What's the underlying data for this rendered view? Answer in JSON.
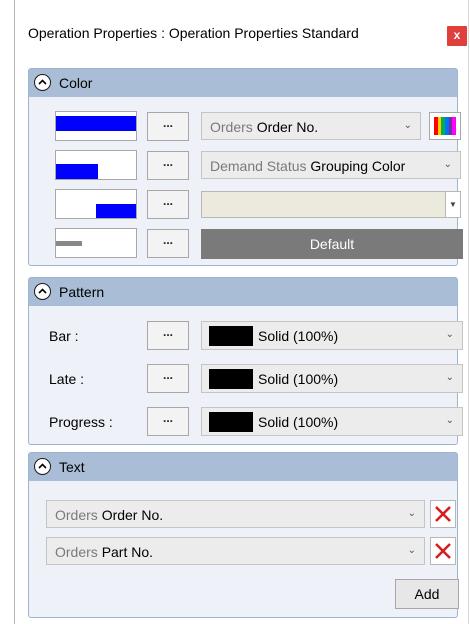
{
  "window": {
    "title": "Operation Properties : Operation Properties Standard",
    "close_label": "x"
  },
  "sections": {
    "color": {
      "title": "Color",
      "rows": [
        {
          "swatch": "full-blue-bar",
          "button_label": "...",
          "combo_prefix": "Orders",
          "combo_value": "Order No."
        },
        {
          "swatch": "partial-left-blue",
          "button_label": "...",
          "combo_prefix": "Demand Status",
          "combo_value": "Grouping Color"
        },
        {
          "swatch": "partial-right-blue",
          "button_label": "...",
          "combo_value": ""
        },
        {
          "swatch": "gray-dash",
          "button_label": "...",
          "default_label": "Default"
        }
      ],
      "palette_colors": [
        "#ff0000",
        "#ffcc00",
        "#00b050",
        "#0070ff",
        "#7030a0",
        "#ff00ff"
      ]
    },
    "pattern": {
      "title": "Pattern",
      "rows": [
        {
          "label": "Bar :",
          "button_label": "...",
          "value": "Solid (100%)"
        },
        {
          "label": "Late :",
          "button_label": "...",
          "value": "Solid (100%)"
        },
        {
          "label": "Progress :",
          "button_label": "...",
          "value": "Solid (100%)"
        }
      ]
    },
    "text": {
      "title": "Text",
      "items": [
        {
          "prefix": "Orders",
          "value": "Order No."
        },
        {
          "prefix": "Orders",
          "value": "Part No."
        }
      ],
      "add_label": "Add"
    }
  },
  "colors": {
    "swatch_blue": "#0000ff",
    "header_blue": "#a9bdd6",
    "close_red": "#e0403c",
    "delete_red": "#d42020"
  }
}
